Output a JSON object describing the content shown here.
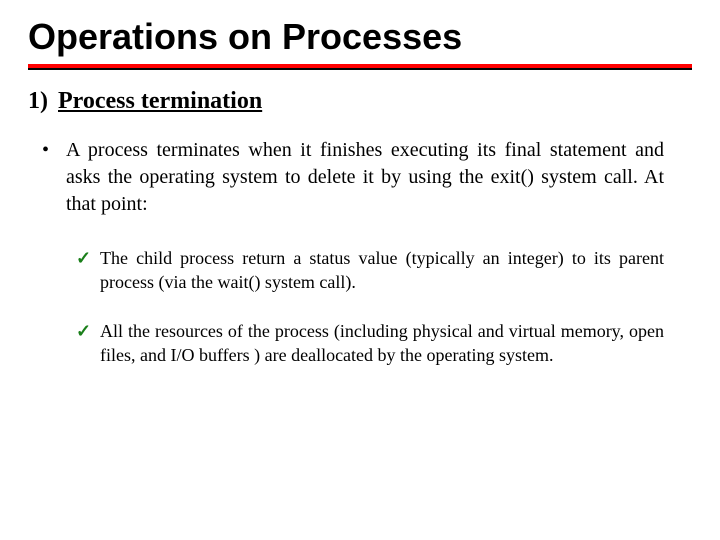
{
  "title": "Operations on Processes",
  "section": {
    "number": "1)",
    "heading": "Process termination"
  },
  "bullet_text": "A process terminates when it finishes executing its final statement and asks the operating system to delete it by using the exit() system call. At that point:",
  "checks": [
    "The child process return a status value (typically an integer) to its parent process (via the wait() system call).",
    "All the resources of the process (including physical and virtual memory, open files, and I/O buffers ) are deallocated by the operating system."
  ],
  "glyphs": {
    "bullet": "•",
    "check": "✓"
  }
}
